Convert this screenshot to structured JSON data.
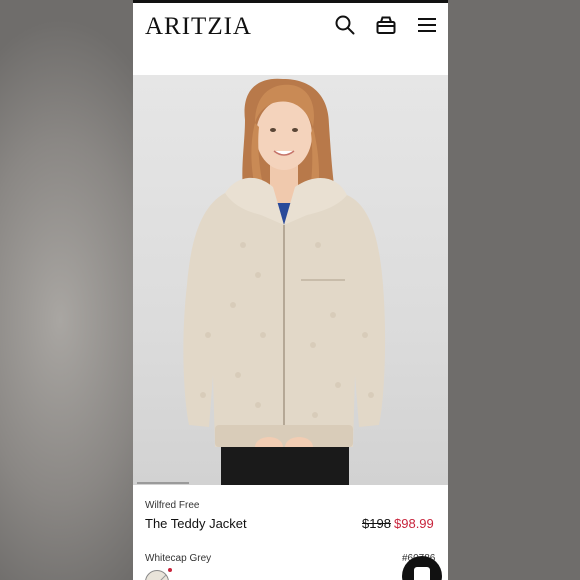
{
  "header": {
    "logo": "ARITZIA",
    "icons": [
      "search-icon",
      "bag-icon",
      "menu-icon"
    ]
  },
  "hero": {
    "image": "model-wearing-teddy-jacket",
    "gallery_progress": 0.17
  },
  "product": {
    "brand": "Wilfred Free",
    "name": "The Teddy Jacket",
    "price_original": "$198",
    "price_sale": "$98.99",
    "color_name": "Whitecap Grey",
    "style_number": "#60786"
  },
  "colors": {
    "sale": "#c8243c",
    "text": "#111111",
    "jacket": "#e2d8c8"
  }
}
